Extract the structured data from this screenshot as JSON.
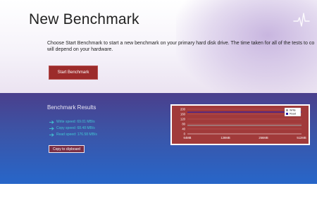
{
  "header": {
    "title": "New Benchmark",
    "description_line1": "Choose Start Benchmark to start a new benchmark on your primary hard disk drive.  The time taken for all of the tests to co",
    "description_line2": "will depend on your hardware.",
    "start_button_label": "Start Benchmark",
    "icon": "pulse-icon"
  },
  "results": {
    "title": "Benchmark Results",
    "lines": [
      {
        "text": "Write speed: 69.01 MB/s",
        "icon": "arrow-right-icon"
      },
      {
        "text": "Copy speed: 68.48 MB/s",
        "icon": "arrow-right-icon"
      },
      {
        "text": "Read speed: 176.58 MB/s",
        "icon": "arrow-right-icon"
      }
    ],
    "copy_button_label": "Copy to clipboard"
  },
  "chart_data": {
    "type": "line",
    "x": [
      "64MB",
      "128MB",
      "256MB",
      "512MB"
    ],
    "y_ticks": [
      "200",
      "160",
      "120",
      "80",
      "40",
      "0"
    ],
    "ylim": [
      0,
      200
    ],
    "series": [
      {
        "name": "Write",
        "values": [
          69,
          69,
          69,
          69
        ],
        "color": "#a0a0a0"
      },
      {
        "name": "Read",
        "values": [
          176,
          177,
          177,
          177
        ],
        "color": "#2b1fa8"
      }
    ],
    "legend_position": "top-right",
    "grid": true,
    "background": "#a13a3a"
  },
  "colors": {
    "accent_button": "#9c2b2b",
    "result_text": "#41c7d3",
    "band_top": "#4a3f8c",
    "band_bottom": "#2766c9"
  }
}
